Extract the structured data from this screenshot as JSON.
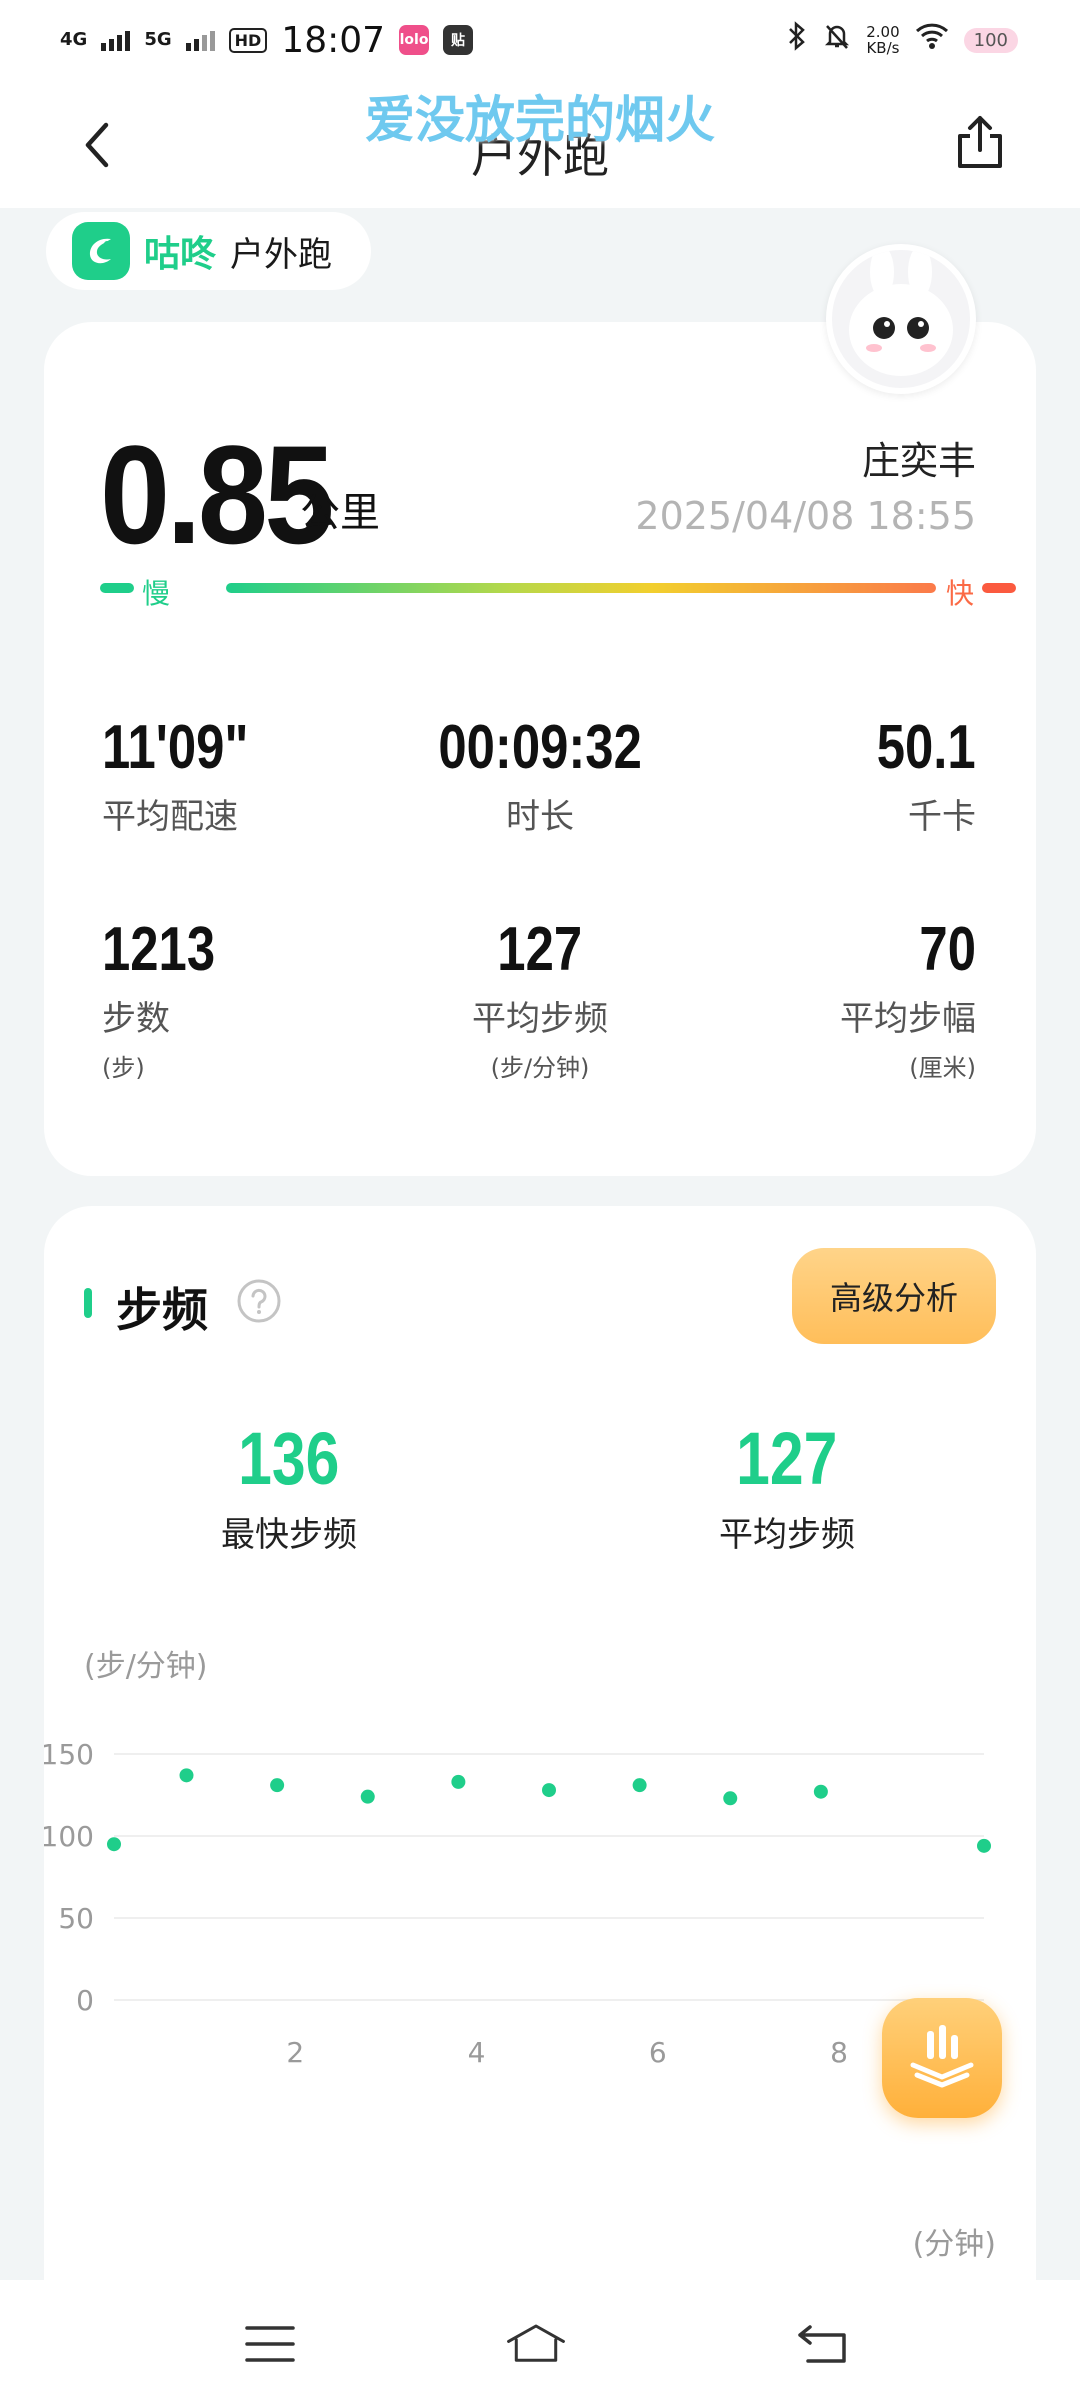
{
  "status_bar": {
    "network_1": "4G",
    "network_2": "5G",
    "hd_badge": "HD",
    "time": "18:07",
    "app_icon_1": "lolo",
    "app_icon_2": "贴",
    "speed_value": "2.00",
    "speed_unit": "KB/s",
    "battery": "100"
  },
  "header": {
    "title": "户外跑",
    "overlay_caption": "爱没放完的烟火"
  },
  "brand": {
    "name": "咕咚",
    "sport": "户外跑"
  },
  "summary": {
    "distance": "0.85",
    "distance_unit": "公里",
    "user_name": "庄奕丰",
    "date": "2025/04/08 18:55",
    "pace_slow": "慢",
    "pace_fast": "快",
    "stats": [
      {
        "value": "11'09\"",
        "label": "平均配速"
      },
      {
        "value": "00:09:32",
        "label": "时长"
      },
      {
        "value": "50.1",
        "label": "千卡"
      },
      {
        "value": "1213",
        "label": "步数",
        "unit": "(步)"
      },
      {
        "value": "127",
        "label": "平均步频",
        "unit": "(步/分钟)"
      },
      {
        "value": "70",
        "label": "平均步幅",
        "unit": "(厘米)"
      }
    ]
  },
  "cadence": {
    "title": "步频",
    "advanced_button": "高级分析",
    "fastest_value": "136",
    "fastest_label": "最快步频",
    "average_value": "127",
    "average_label": "平均步频"
  },
  "colors": {
    "accent": "#1fce8a",
    "fast": "#fb5a3f",
    "button": "#ffbe5a"
  },
  "icons": [
    "back-icon",
    "share-icon",
    "help-icon",
    "menu-icon",
    "home-icon",
    "return-icon",
    "chart-bars-icon"
  ],
  "chart_data": {
    "type": "scatter",
    "ylabel": "(步/分钟)",
    "xlabel": "(分钟)",
    "ylim": [
      0,
      150
    ],
    "xlim": [
      0,
      9.6
    ],
    "yticks": [
      0,
      50,
      100,
      150
    ],
    "xticks": [
      2,
      4,
      6,
      8
    ],
    "grid": true,
    "x": [
      0,
      0.8,
      1.8,
      2.8,
      3.8,
      4.8,
      5.8,
      6.8,
      7.8,
      9.6
    ],
    "y": [
      95,
      137,
      131,
      124,
      133,
      128,
      131,
      123,
      127,
      94
    ]
  }
}
